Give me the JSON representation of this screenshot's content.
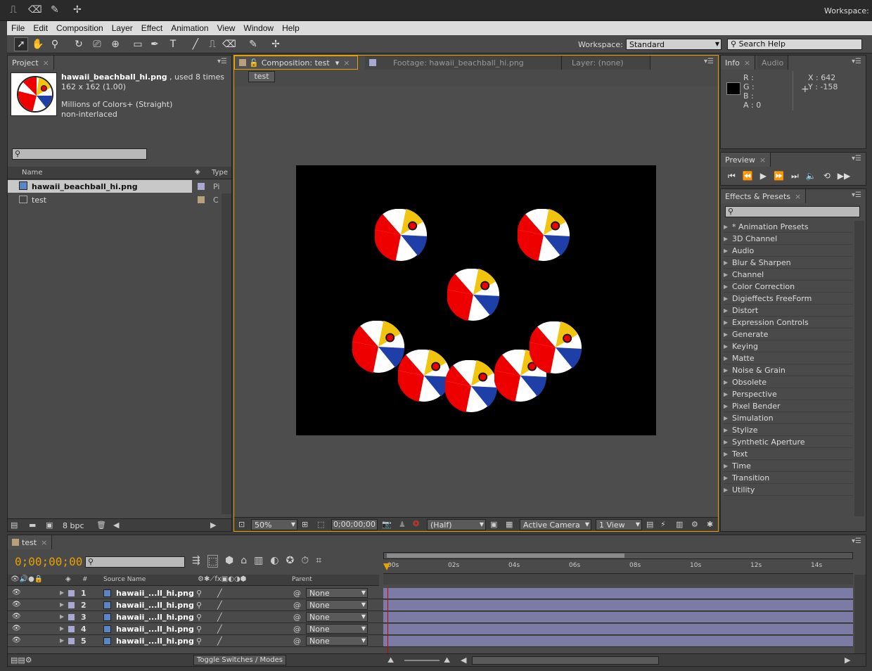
{
  "workspace_top": "Workspace:",
  "menu": [
    "File",
    "Edit",
    "Composition",
    "Layer",
    "Effect",
    "Animation",
    "View",
    "Window",
    "Help"
  ],
  "toolbar": {
    "workspace_label": "Workspace:",
    "workspace_value": "Standard",
    "search_help": "Search Help"
  },
  "project": {
    "tab": "Project",
    "file_name": "hawaii_beachball_hi.png",
    "used": ", used 8 times",
    "dims": "162 x 162 (1.00)",
    "colors": "Millions of Colors+ (Straight)",
    "interlace": "non-interlaced",
    "col_name": "Name",
    "col_type": "Type",
    "items": [
      {
        "name": "hawaii_beachball_hi.png",
        "type": "Pi"
      },
      {
        "name": "test",
        "type": "C"
      }
    ],
    "bpc": "8 bpc"
  },
  "comp": {
    "tab_comp": "Composition: test",
    "tab_footage": "Footage: hawaii_beachball_hi.png",
    "tab_layer": "Layer: (none)",
    "comp_btn": "test",
    "zoom": "50%",
    "timecode": "0;00;00;00",
    "resolution": "(Half)",
    "camera": "Active Camera",
    "views": "1 View"
  },
  "info": {
    "tab": "Info",
    "tab2": "Audio",
    "r": "R :",
    "g": "G :",
    "b": "B :",
    "a": "A : 0",
    "x": "X : 642",
    "y": "Y : -158"
  },
  "preview": {
    "tab": "Preview"
  },
  "effects": {
    "tab": "Effects & Presets",
    "items": [
      "* Animation Presets",
      "3D Channel",
      "Audio",
      "Blur & Sharpen",
      "Channel",
      "Color Correction",
      "Digieffects FreeForm",
      "Distort",
      "Expression Controls",
      "Generate",
      "Keying",
      "Matte",
      "Noise & Grain",
      "Obsolete",
      "Perspective",
      "Pixel Bender",
      "Simulation",
      "Stylize",
      "Synthetic Aperture",
      "Text",
      "Time",
      "Transition",
      "Utility"
    ]
  },
  "timeline": {
    "tab": "test",
    "timecode": "0;00;00;00",
    "col_num": "#",
    "col_source": "Source Name",
    "col_parent": "Parent",
    "ticks": [
      "00s",
      "02s",
      "04s",
      "06s",
      "08s",
      "10s",
      "12s",
      "14s"
    ],
    "layers": [
      {
        "num": "1",
        "name": "hawaii_...ll_hi.png",
        "parent": "None"
      },
      {
        "num": "2",
        "name": "hawaii_...ll_hi.png",
        "parent": "None"
      },
      {
        "num": "3",
        "name": "hawaii_...ll_hi.png",
        "parent": "None"
      },
      {
        "num": "4",
        "name": "hawaii_...ll_hi.png",
        "parent": "None"
      },
      {
        "num": "5",
        "name": "hawaii_...ll_hi.png",
        "parent": "None"
      }
    ],
    "toggle": "Toggle Switches / Modes"
  },
  "colors": {
    "accent": "#e8a100",
    "panel": "#4a4a4a",
    "bar": "#7b7ba6"
  }
}
